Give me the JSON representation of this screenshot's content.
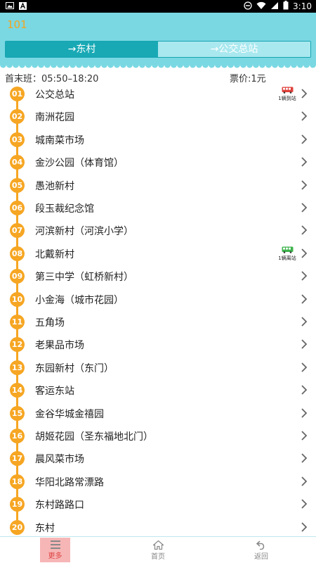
{
  "status_bar": {
    "time": "3:10"
  },
  "header": {
    "title": "101"
  },
  "direction_tabs": [
    {
      "label": "→东村",
      "active": true
    },
    {
      "label": "→公交总站",
      "active": false
    }
  ],
  "info": {
    "schedule": "首末班：05:50–18:20",
    "fare": "票价:1元"
  },
  "stops": [
    {
      "num": "01",
      "name": "公交总站",
      "bus": {
        "text": "1辆到站",
        "color": "#e0403a"
      }
    },
    {
      "num": "02",
      "name": "南洲花园"
    },
    {
      "num": "03",
      "name": "城南菜市场"
    },
    {
      "num": "04",
      "name": "金沙公园（体育馆）"
    },
    {
      "num": "05",
      "name": "愚池新村"
    },
    {
      "num": "06",
      "name": "段玉裁纪念馆"
    },
    {
      "num": "07",
      "name": "河滨新村（河滨小学）"
    },
    {
      "num": "08",
      "name": "北戴新村",
      "bus": {
        "text": "1辆离站",
        "color": "#3bb34a"
      }
    },
    {
      "num": "09",
      "name": "第三中学（虹桥新村）"
    },
    {
      "num": "10",
      "name": "小金海（城市花园）"
    },
    {
      "num": "11",
      "name": "五角场"
    },
    {
      "num": "12",
      "name": "老果品市场"
    },
    {
      "num": "13",
      "name": "东园新村（东门）"
    },
    {
      "num": "14",
      "name": "客运东站"
    },
    {
      "num": "15",
      "name": "金谷华城金禧园"
    },
    {
      "num": "16",
      "name": "胡姬花园（圣东福地北门）"
    },
    {
      "num": "17",
      "name": "晨风菜市场"
    },
    {
      "num": "18",
      "name": "华阳北路常漂路"
    },
    {
      "num": "19",
      "name": "东村路路口"
    },
    {
      "num": "20",
      "name": "东村"
    }
  ],
  "bottom_nav": [
    {
      "label": "更多",
      "icon": "menu-icon",
      "active": true
    },
    {
      "label": "首页",
      "icon": "home-icon",
      "active": false
    },
    {
      "label": "返回",
      "icon": "back-icon",
      "active": false
    }
  ],
  "colors": {
    "header_bg": "#7ad8e2",
    "tab_active": "#18a9b5",
    "stop_badge": "#f6a623",
    "title": "#f3a51f"
  }
}
